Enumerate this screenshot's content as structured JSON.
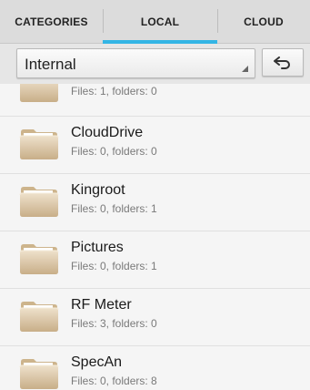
{
  "colors": {
    "accent": "#33b5e5",
    "folder_light": "#e9d9bf",
    "folder_dark": "#bfa57e"
  },
  "tabs": [
    {
      "label": "CATEGORIES",
      "selected": false
    },
    {
      "label": "LOCAL",
      "selected": true
    },
    {
      "label": "CLOUD",
      "selected": false
    }
  ],
  "toolbar": {
    "path_value": "Internal",
    "back_icon": "back-arrow-icon"
  },
  "files": [
    {
      "name": "",
      "meta": "Files: 1, folders: 0",
      "icon": "folder-icon"
    },
    {
      "name": "CloudDrive",
      "meta": "Files: 0, folders: 0",
      "icon": "folder-icon"
    },
    {
      "name": "Kingroot",
      "meta": "Files: 0, folders: 1",
      "icon": "folder-icon"
    },
    {
      "name": "Pictures",
      "meta": "Files: 0, folders: 1",
      "icon": "folder-icon"
    },
    {
      "name": "RF Meter",
      "meta": "Files: 3, folders: 0",
      "icon": "folder-icon"
    },
    {
      "name": "SpecAn",
      "meta": "Files: 0, folders: 8",
      "icon": "folder-icon"
    }
  ]
}
